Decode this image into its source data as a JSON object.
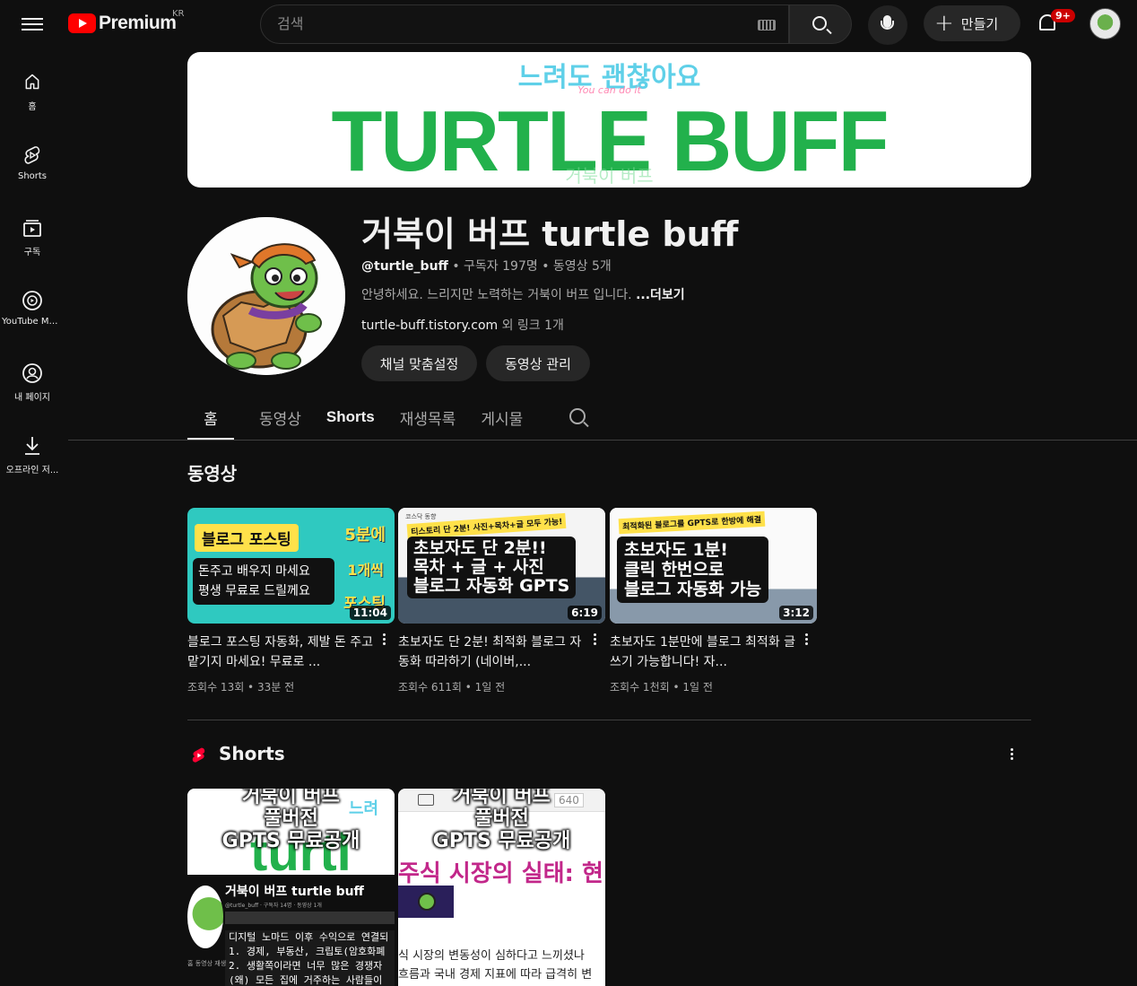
{
  "header": {
    "logo_text": "Premium",
    "region": "KR",
    "search_placeholder": "검색",
    "create_label": "만들기",
    "notification_count": "9+"
  },
  "sidebar": {
    "items": [
      {
        "label": "홈",
        "icon": "home-icon"
      },
      {
        "label": "Shorts",
        "icon": "shorts-icon"
      },
      {
        "label": "구독",
        "icon": "subscriptions-icon"
      },
      {
        "label": "YouTube Mu...",
        "icon": "youtube-music-icon"
      },
      {
        "label": "내 페이지",
        "icon": "my-page-icon"
      },
      {
        "label": "오프라인 저...",
        "icon": "download-icon"
      }
    ]
  },
  "banner": {
    "subtitle": "느려도 괜찮아요",
    "script": "You can do it",
    "title": "TURTLE BUFF",
    "korean_name": "거북이 버프"
  },
  "channel": {
    "name": "거북이 버프 turtle buff",
    "handle": "@turtle_buff",
    "stats": " • 구독자 197명 • 동영상 5개",
    "description": "안녕하세요. 느리지만 노력하는 거북이 버프 입니다. ",
    "more": "...더보기",
    "link": "turtle-buff.tistory.com",
    "link_suffix": " 외 링크 1개",
    "customize_button": "채널 맞춤설정",
    "manage_button": "동영상 관리"
  },
  "tabs": [
    {
      "label": "홈"
    },
    {
      "label": "동영상"
    },
    {
      "label": "Shorts"
    },
    {
      "label": "재생목록"
    },
    {
      "label": "게시물"
    }
  ],
  "videos_section": {
    "title": "동영상",
    "items": [
      {
        "title": "블로그 포스팅 자동화, 제발 돈 주고 맡기지 마세요! 무료로 ...",
        "meta": "조회수 13회 • 33분 전",
        "duration": "11:04",
        "thumb_lines": [
          "블로그 포스팅",
          "5분에",
          "돈주고 배우지 마세요",
          "평생 무료로 드릴께요",
          "1개씩",
          "포스팅"
        ]
      },
      {
        "title": "초보자도 단 2분! 최적화 블로그 자동화 따라하기 (네이버,...",
        "meta": "조회수 611회 • 1일 전",
        "duration": "6:19",
        "thumb_lines": [
          "티스토리 단 2분! 사진+목차+글 모두 가능!",
          "초보자도 단 2분!!",
          "목차 + 글 + 사진",
          "블로그 자동화 GPTS",
          "코스닥 동향"
        ]
      },
      {
        "title": "초보자도 1분만에 블로그 최적화 글쓰기 가능합니다! 자...",
        "meta": "조회수 1천회 • 1일 전",
        "duration": "3:12",
        "thumb_lines": [
          "최적화된 블로그를 GPTS로 한방에 해결",
          "초보자도 1분!",
          "클릭 한번으로",
          "블로그 자동화 가능"
        ]
      }
    ]
  },
  "shorts_section": {
    "title": "Shorts",
    "items": [
      {
        "caption": [
          "거북이 버프",
          "풀버전",
          "GPTS 무료공개"
        ],
        "channel_name": "거북이 버프 turtle buff",
        "handle_line": "@turtle_buff · 구독자 14명 · 동영상 1개",
        "text_lines": [
          "디지털 노마드 이후 수익으로 연결되",
          "1. 경제, 부동산, 크립토(암호화폐",
          "2. 생활쪽이라면 너무 많은 경쟁자",
          "(왜) 모든 집에 거주하는 사람들이"
        ],
        "tab_labels": [
          "홈",
          "동영상",
          "재생"
        ]
      },
      {
        "caption": [
          "거북이 버프",
          "풀버전",
          "GPTS 무료공개"
        ],
        "zoom": "640",
        "headline": "주식 시장의 실태: 현",
        "text_lines": [
          "식 시장의 변동성이 심하다고 느끼셨나",
          "흐름과 국내 경제 지표에 따라 급격히 변"
        ]
      }
    ]
  },
  "colors": {
    "background": "#0f0f0f",
    "youtube_red": "#ff0000",
    "banner_green": "#22b14c",
    "banner_cyan": "#5fd0e8",
    "thumb1_bg": "#2fc9c0",
    "thumb1_yellow": "#ffe14a"
  }
}
